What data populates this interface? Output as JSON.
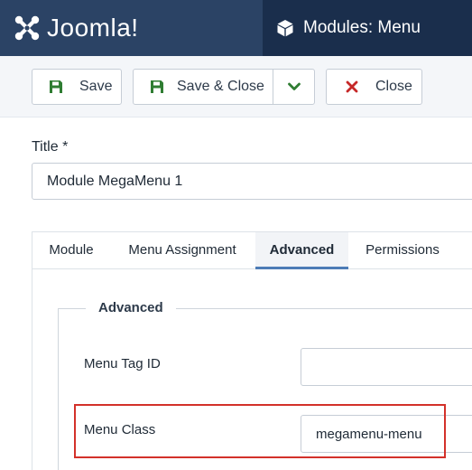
{
  "header": {
    "brand": "Joomla!",
    "page_title": "Modules: Menu",
    "colors": {
      "brand_bg": "#2b4365",
      "header_bg": "#1a2e4c"
    }
  },
  "toolbar": {
    "save_label": "Save",
    "save_close_label": "Save & Close",
    "close_label": "Close",
    "icons": {
      "save": "floppy-disk-icon",
      "dropdown": "chevron-down-icon",
      "close": "x-icon"
    }
  },
  "form": {
    "title_label": "Title *",
    "title_value": "Module MegaMenu 1"
  },
  "tabs": [
    {
      "label": "Module",
      "active": false
    },
    {
      "label": "Menu Assignment",
      "active": false
    },
    {
      "label": "Advanced",
      "active": true
    },
    {
      "label": "Permissions",
      "active": false
    }
  ],
  "advanced": {
    "legend": "Advanced",
    "menu_tag_id_label": "Menu Tag ID",
    "menu_tag_id_value": "",
    "menu_class_label": "Menu Class",
    "menu_class_value": "megamenu-menu"
  },
  "accent_colors": {
    "save_icon": "#2f7d32",
    "close_icon": "#c62828",
    "active_tab": "#4d7cb6",
    "highlight": "#d3312a"
  }
}
